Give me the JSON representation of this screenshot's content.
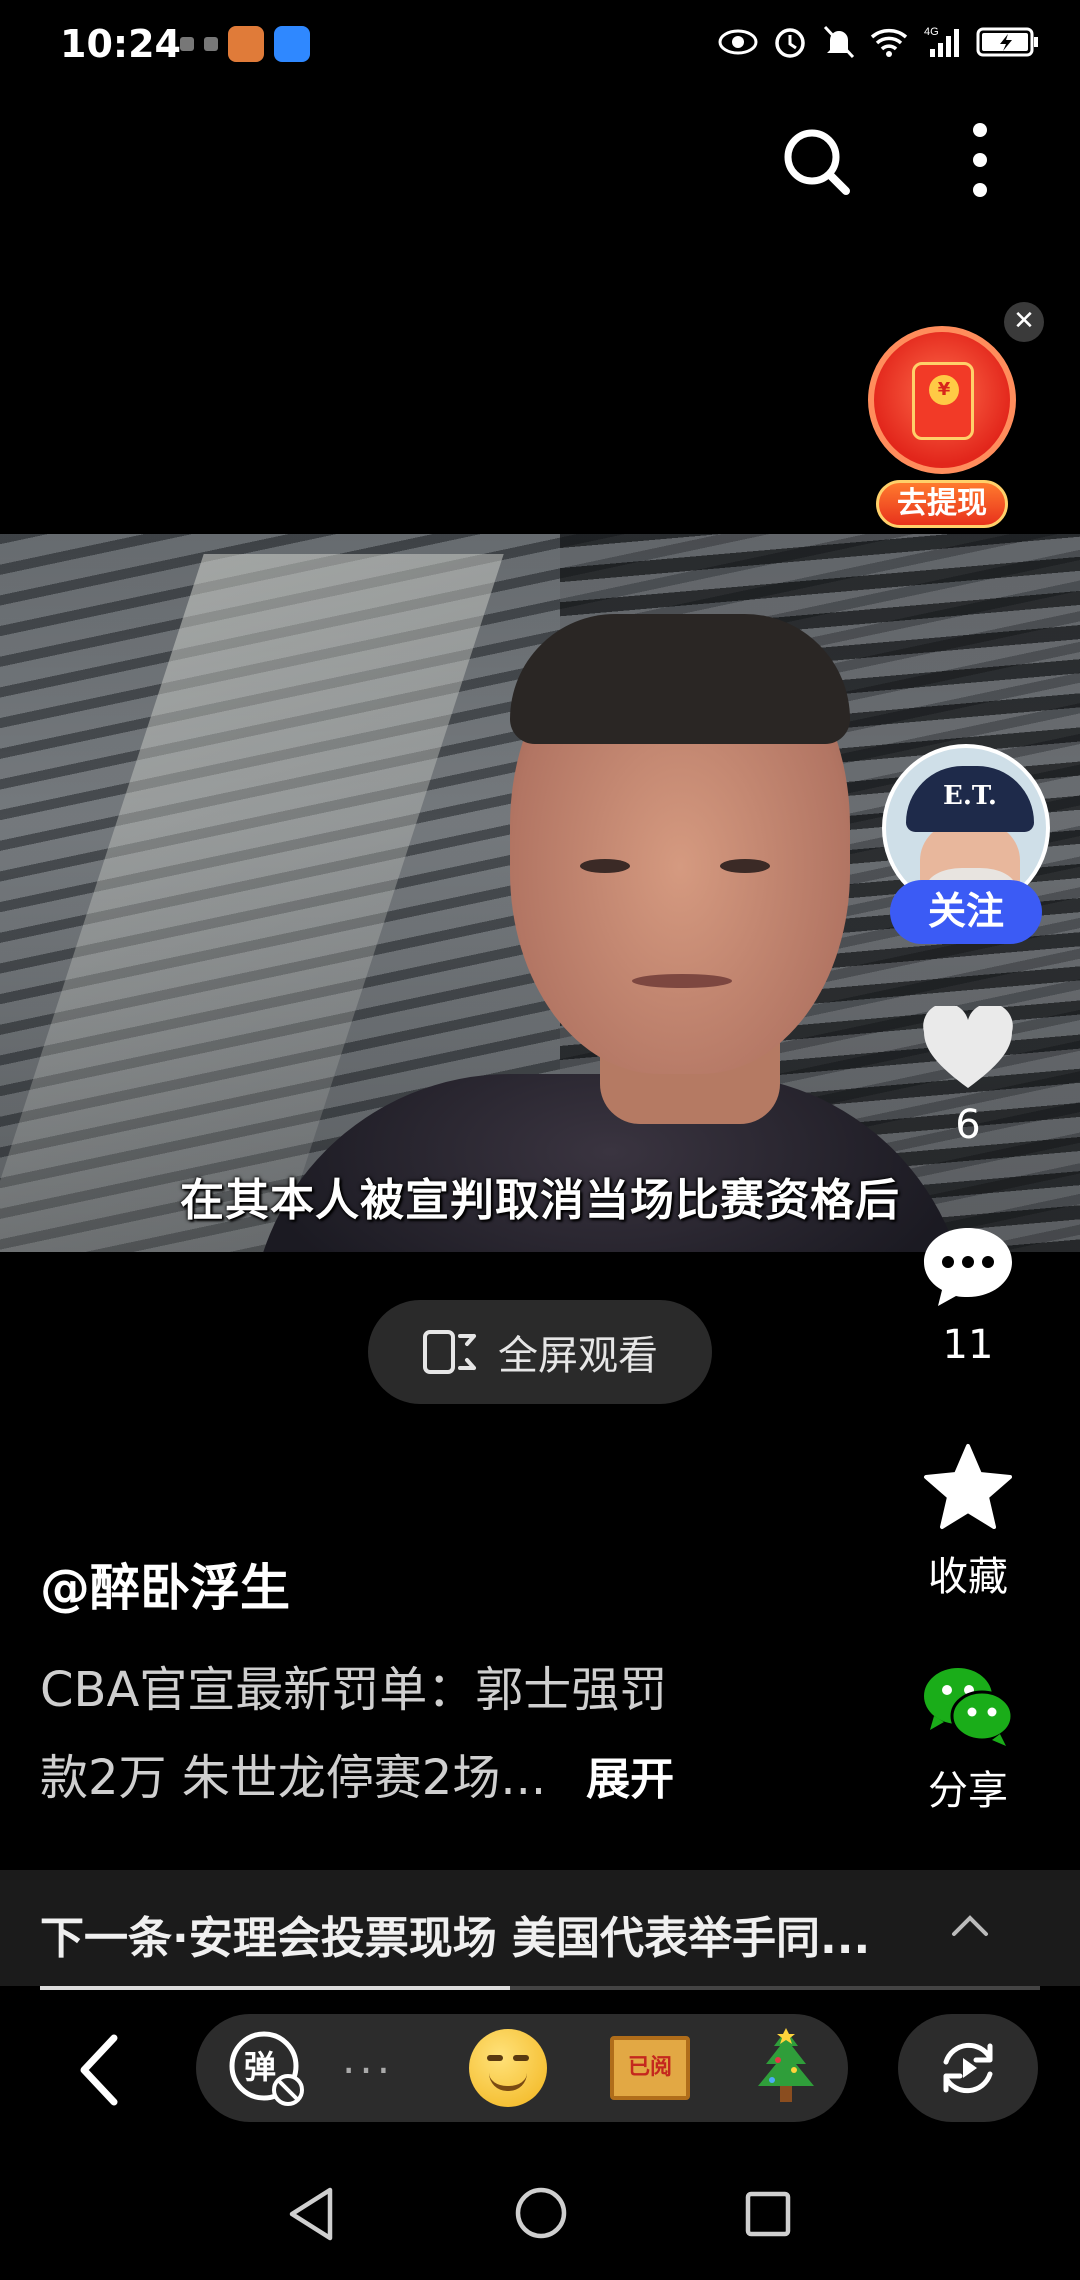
{
  "status_bar": {
    "time": "10:24",
    "network": "4G"
  },
  "top_bar": {
    "search_icon": "search-icon",
    "more_icon": "more-vertical-icon"
  },
  "red_packet": {
    "label": "去提现",
    "close": "✕"
  },
  "video": {
    "subtitle": "在其本人被宣判取消当场比赛资格后"
  },
  "fullscreen": {
    "label": "全屏观看"
  },
  "sidebar": {
    "avatar_text": "E.T.",
    "follow_label": "关注",
    "like_count": "6",
    "comment_count": "11",
    "favorite_label": "收藏",
    "share_label": "分享"
  },
  "post": {
    "author": "@醉卧浮生",
    "description_line1": "CBA官宣最新罚单：郭士强罚",
    "description_line2": "款2万 朱世龙停赛2场...",
    "expand_label": "展开"
  },
  "next_item": {
    "text": "下一条·安理会投票现场 美国代表举手同..."
  },
  "playback": {
    "progress_fraction": 0.47
  },
  "toolbar": {
    "danmaku_label": "弹",
    "ellipsis": "...",
    "read_tag": "已阅"
  },
  "colors": {
    "follow_button": "#3b5bf5",
    "red_packet": "#e2261b",
    "wechat_green": "#1aad19"
  }
}
